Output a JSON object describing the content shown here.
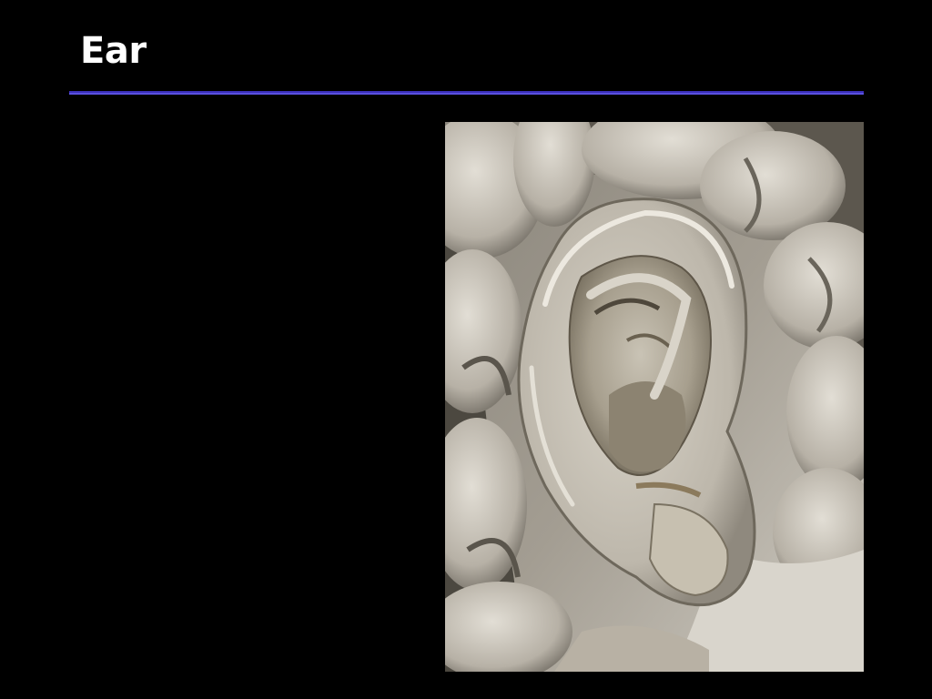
{
  "slide": {
    "title": "Ear",
    "accent_color": "#3a2fb8",
    "background_color": "#000000"
  },
  "photo": {
    "icon": "marble-ear-sculpture-photo"
  }
}
